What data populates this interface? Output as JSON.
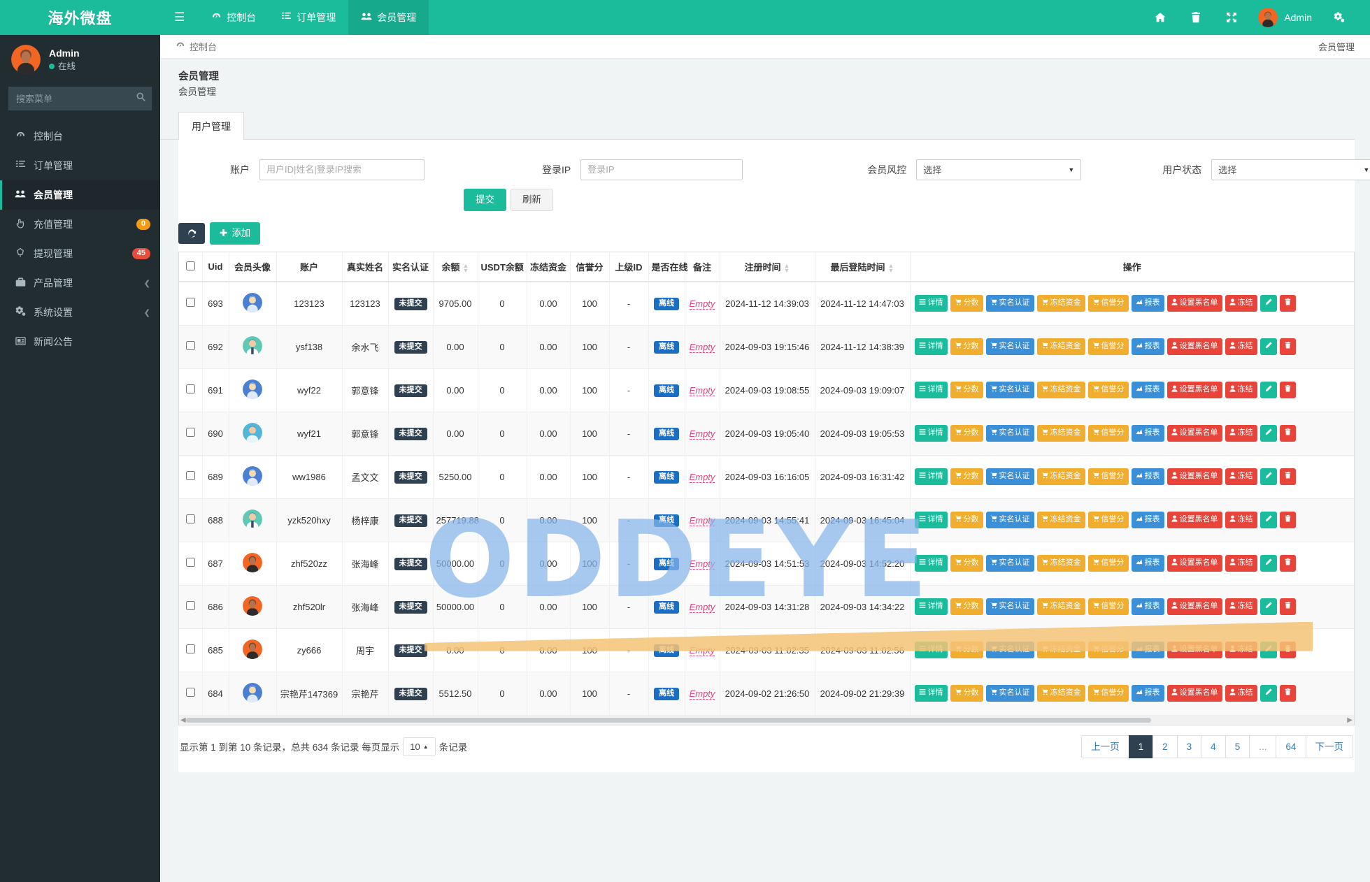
{
  "brand": {
    "title": "海外微盘"
  },
  "topnav": {
    "hamburger_icon": "hamburger-icon",
    "items": [
      {
        "label": "控制台",
        "icon": "dashboard-icon",
        "active": false
      },
      {
        "label": "订单管理",
        "icon": "list-icon",
        "active": false
      },
      {
        "label": "会员管理",
        "icon": "users-icon",
        "active": true
      }
    ],
    "right_icons": [
      "home-icon",
      "trash-icon",
      "fullscreen-icon",
      "settings-gear-icon"
    ],
    "user_name": "Admin"
  },
  "sidebar": {
    "user": {
      "name": "Admin",
      "status": "在线"
    },
    "search": {
      "placeholder": "搜索菜单",
      "value": "",
      "icon": "search-icon"
    },
    "items": [
      {
        "label": "控制台",
        "icon": "dashboard-icon",
        "badge": null,
        "badge_color": null,
        "caret": false,
        "active": false
      },
      {
        "label": "订单管理",
        "icon": "list-icon",
        "badge": null,
        "badge_color": null,
        "caret": false,
        "active": false
      },
      {
        "label": "会员管理",
        "icon": "users-icon",
        "badge": null,
        "badge_color": null,
        "caret": false,
        "active": true
      },
      {
        "label": "充值管理",
        "icon": "hand-icon",
        "badge": "0",
        "badge_color": "#f39c12",
        "caret": false,
        "active": false
      },
      {
        "label": "提现管理",
        "icon": "diamond-icon",
        "badge": "45",
        "badge_color": "#e74c3c",
        "caret": false,
        "active": false
      },
      {
        "label": "产品管理",
        "icon": "briefcase-icon",
        "badge": null,
        "badge_color": null,
        "caret": true,
        "active": false
      },
      {
        "label": "系统设置",
        "icon": "gears-icon",
        "badge": null,
        "badge_color": null,
        "caret": true,
        "active": false
      },
      {
        "label": "新闻公告",
        "icon": "news-icon",
        "badge": null,
        "badge_color": null,
        "caret": false,
        "active": false
      }
    ]
  },
  "breadcrumb": {
    "icon": "dashboard-icon",
    "text": "控制台",
    "right": "会员管理"
  },
  "page": {
    "title": "会员管理",
    "subtitle": "会员管理"
  },
  "tabs": [
    {
      "label": "用户管理",
      "active": true
    }
  ],
  "filters": {
    "account": {
      "label": "账户",
      "placeholder": "用户ID|姓名|登录IP搜索",
      "value": ""
    },
    "login_ip": {
      "label": "登录IP",
      "placeholder": "登录IP",
      "value": ""
    },
    "risk": {
      "label": "会员风控",
      "value": "选择",
      "options": [
        "选择"
      ]
    },
    "status": {
      "label": "用户状态",
      "value": "选择",
      "options": [
        "选择"
      ]
    },
    "submit_label": "提交",
    "reset_label": "刷新"
  },
  "toolbar": {
    "refresh_icon": "refresh-icon",
    "add_label": "添加",
    "add_icon": "plus-icon"
  },
  "table": {
    "columns": [
      {
        "key": "check",
        "label": "",
        "sortable": false
      },
      {
        "key": "uid",
        "label": "Uid",
        "sortable": false
      },
      {
        "key": "avatar",
        "label": "会员头像",
        "sortable": false
      },
      {
        "key": "account",
        "label": "账户",
        "sortable": false
      },
      {
        "key": "realname",
        "label": "真实姓名",
        "sortable": false
      },
      {
        "key": "verify",
        "label": "实名认证",
        "sortable": false
      },
      {
        "key": "balance",
        "label": "余额",
        "sortable": true
      },
      {
        "key": "usdt",
        "label": "USDT余额",
        "sortable": false
      },
      {
        "key": "frozen",
        "label": "冻结资金",
        "sortable": false
      },
      {
        "key": "credit",
        "label": "信誉分",
        "sortable": false
      },
      {
        "key": "parent",
        "label": "上级ID",
        "sortable": false
      },
      {
        "key": "online",
        "label": "是否在线",
        "sortable": false
      },
      {
        "key": "remark",
        "label": "备注",
        "sortable": false
      },
      {
        "key": "reg_time",
        "label": "注册时间",
        "sortable": true
      },
      {
        "key": "last_login",
        "label": "最后登陆时间",
        "sortable": true
      },
      {
        "key": "ops",
        "label": "操作",
        "sortable": false
      }
    ],
    "rows": [
      {
        "uid": "693",
        "avatar_color": "#4a7fd4",
        "account": "123123",
        "realname": "123123",
        "verify": "未提交",
        "balance": "9705.00",
        "usdt": "0",
        "frozen": "0.00",
        "credit": "100",
        "parent": "-",
        "online": "离线",
        "remark": "Empty",
        "reg_time": "2024-11-12 14:39:03",
        "last_login": "2024-11-12 14:47:03"
      },
      {
        "uid": "692",
        "avatar_color": "#5fc9b8",
        "account": "ysf138",
        "realname": "余水飞",
        "verify": "未提交",
        "balance": "0.00",
        "usdt": "0",
        "frozen": "0.00",
        "credit": "100",
        "parent": "-",
        "online": "离线",
        "remark": "Empty",
        "reg_time": "2024-09-03 19:15:46",
        "last_login": "2024-11-12 14:38:39"
      },
      {
        "uid": "691",
        "avatar_color": "#4a7fd4",
        "account": "wyf22",
        "realname": "郭意锋",
        "verify": "未提交",
        "balance": "0.00",
        "usdt": "0",
        "frozen": "0.00",
        "credit": "100",
        "parent": "-",
        "online": "离线",
        "remark": "Empty",
        "reg_time": "2024-09-03 19:08:55",
        "last_login": "2024-09-03 19:09:07"
      },
      {
        "uid": "690",
        "avatar_color": "#51b6d8",
        "account": "wyf21",
        "realname": "郭意锋",
        "verify": "未提交",
        "balance": "0.00",
        "usdt": "0",
        "frozen": "0.00",
        "credit": "100",
        "parent": "-",
        "online": "离线",
        "remark": "Empty",
        "reg_time": "2024-09-03 19:05:40",
        "last_login": "2024-09-03 19:05:53"
      },
      {
        "uid": "689",
        "avatar_color": "#4a7fd4",
        "account": "ww1986",
        "realname": "孟文文",
        "verify": "未提交",
        "balance": "5250.00",
        "usdt": "0",
        "frozen": "0.00",
        "credit": "100",
        "parent": "-",
        "online": "离线",
        "remark": "Empty",
        "reg_time": "2024-09-03 16:16:05",
        "last_login": "2024-09-03 16:31:42"
      },
      {
        "uid": "688",
        "avatar_color": "#5fc9b8",
        "account": "yzk520hxy",
        "realname": "杨梓康",
        "verify": "未提交",
        "balance": "257719.88",
        "usdt": "0",
        "frozen": "0.00",
        "credit": "100",
        "parent": "-",
        "online": "离线",
        "remark": "Empty",
        "reg_time": "2024-09-03 14:55:41",
        "last_login": "2024-09-03 16:45:04"
      },
      {
        "uid": "687",
        "avatar_color": "#f26522",
        "account": "zhf520zz",
        "realname": "张海峰",
        "verify": "未提交",
        "balance": "50000.00",
        "usdt": "0",
        "frozen": "0.00",
        "credit": "100",
        "parent": "-",
        "online": "离线",
        "remark": "Empty",
        "reg_time": "2024-09-03 14:51:53",
        "last_login": "2024-09-03 14:52:20"
      },
      {
        "uid": "686",
        "avatar_color": "#f26522",
        "account": "zhf520lr",
        "realname": "张海峰",
        "verify": "未提交",
        "balance": "50000.00",
        "usdt": "0",
        "frozen": "0.00",
        "credit": "100",
        "parent": "-",
        "online": "离线",
        "remark": "Empty",
        "reg_time": "2024-09-03 14:31:28",
        "last_login": "2024-09-03 14:34:22"
      },
      {
        "uid": "685",
        "avatar_color": "#f26522",
        "account": "zy666",
        "realname": "周宇",
        "verify": "未提交",
        "balance": "0.00",
        "usdt": "0",
        "frozen": "0.00",
        "credit": "100",
        "parent": "-",
        "online": "离线",
        "remark": "Empty",
        "reg_time": "2024-09-03 11:02:35",
        "last_login": "2024-09-03 11:02:56"
      },
      {
        "uid": "684",
        "avatar_color": "#4a7fd4",
        "account": "宗艳芹147369",
        "realname": "宗艳芹",
        "verify": "未提交",
        "balance": "5512.50",
        "usdt": "0",
        "frozen": "0.00",
        "credit": "100",
        "parent": "-",
        "online": "离线",
        "remark": "Empty",
        "reg_time": "2024-09-02 21:26:50",
        "last_login": "2024-09-02 21:29:39"
      }
    ],
    "row_actions": [
      {
        "label": "详情",
        "color": "teal",
        "icon": "list-icon"
      },
      {
        "label": "分数",
        "color": "orange",
        "icon": "cart-icon"
      },
      {
        "label": "实名认证",
        "color": "blue",
        "icon": "cart-icon"
      },
      {
        "label": "冻结资金",
        "color": "orange",
        "icon": "cart-icon"
      },
      {
        "label": "信誉分",
        "color": "orange",
        "icon": "cart-icon"
      },
      {
        "label": "报表",
        "color": "blue",
        "icon": "chart-icon"
      },
      {
        "label": "设置黑名单",
        "color": "red",
        "icon": "user-icon"
      },
      {
        "label": "冻结",
        "color": "red",
        "icon": "user-icon"
      },
      {
        "label": "",
        "color": "teal",
        "icon": "pencil-icon"
      },
      {
        "label": "",
        "color": "red",
        "icon": "trash-icon"
      }
    ]
  },
  "footer": {
    "info_prefix": "显示第 1 到第 10 条记录，总共 634 条记录 每页显示",
    "page_size": "10",
    "info_suffix": "条记录",
    "pager": [
      {
        "label": "上一页",
        "active": false
      },
      {
        "label": "1",
        "active": true
      },
      {
        "label": "2",
        "active": false
      },
      {
        "label": "3",
        "active": false
      },
      {
        "label": "4",
        "active": false
      },
      {
        "label": "5",
        "active": false
      },
      {
        "label": "...",
        "active": false,
        "dots": true
      },
      {
        "label": "64",
        "active": false
      },
      {
        "label": "下一页",
        "active": false
      }
    ]
  },
  "watermark": {
    "text": "ODDEYE"
  },
  "colors": {
    "brand": "#1abc9c",
    "sidebar": "#222d32",
    "dark": "#2f4050"
  }
}
